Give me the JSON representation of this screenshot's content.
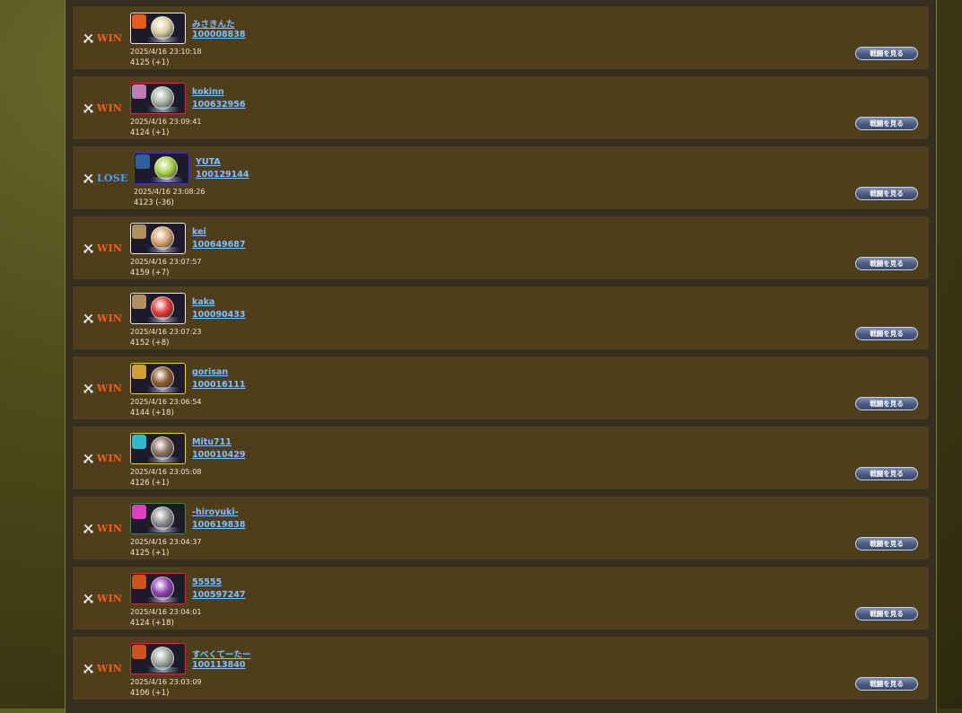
{
  "battles": [
    {
      "result": "WIN",
      "name": "みさきんた",
      "id": "100008838",
      "datetime": "2025/4/16 23:10:18",
      "rating": "4125 (+1)",
      "button": "戦闘を見る",
      "avatar_border": "#e8e8e8",
      "badge_color": "#e85a1a",
      "char_color": "#d8cfa0"
    },
    {
      "result": "WIN",
      "name": "kokinn",
      "id": "100632956",
      "datetime": "2025/4/16 23:09:41",
      "rating": "4124 (+1)",
      "button": "戦闘を見る",
      "avatar_border": "#d03030",
      "badge_color": "#c07ab8",
      "char_color": "#a8b0a0"
    },
    {
      "result": "LOSE",
      "name": "YUTA",
      "id": "100129144",
      "datetime": "2025/4/16 23:08:26",
      "rating": "4123 (-36)",
      "button": "戦闘を見る",
      "avatar_border": "#3a3aa0",
      "badge_color": "#3060a0",
      "char_color": "#a8d048"
    },
    {
      "result": "WIN",
      "name": "kei",
      "id": "100649687",
      "datetime": "2025/4/16 23:07:57",
      "rating": "4159 (+7)",
      "button": "戦闘を見る",
      "avatar_border": "#e8e8e8",
      "badge_color": "#b09060",
      "char_color": "#d8a070"
    },
    {
      "result": "WIN",
      "name": "kaka",
      "id": "100090433",
      "datetime": "2025/4/16 23:07:23",
      "rating": "4152 (+8)",
      "button": "戦闘を見る",
      "avatar_border": "#e8e8e8",
      "badge_color": "#b09060",
      "char_color": "#e03838"
    },
    {
      "result": "WIN",
      "name": "gorisan",
      "id": "100016111",
      "datetime": "2025/4/16 23:06:54",
      "rating": "4144 (+18)",
      "button": "戦闘を見る",
      "avatar_border": "#e8d040",
      "badge_color": "#d0a030",
      "char_color": "#8a5a30"
    },
    {
      "result": "WIN",
      "name": "Mitu711",
      "id": "100010429",
      "datetime": "2025/4/16 23:05:08",
      "rating": "4126 (+1)",
      "button": "戦闘を見る",
      "avatar_border": "#e8d040",
      "badge_color": "#30b8d0",
      "char_color": "#8a7060"
    },
    {
      "result": "WIN",
      "name": "-hiroyuki-",
      "id": "100619838",
      "datetime": "2025/4/16 23:04:37",
      "rating": "4125 (+1)",
      "button": "戦闘を見る",
      "avatar_border": "#3a8a3a",
      "badge_color": "#e040c0",
      "char_color": "#909090"
    },
    {
      "result": "WIN",
      "name": "55555",
      "id": "100597247",
      "datetime": "2025/4/16 23:04:01",
      "rating": "4124 (+18)",
      "button": "戦闘を見る",
      "avatar_border": "#d03030",
      "badge_color": "#d05020",
      "char_color": "#9040b0"
    },
    {
      "result": "WIN",
      "name": "すべくてーたー",
      "id": "100113840",
      "datetime": "2025/4/16 23:03:09",
      "rating": "4106 (+1)",
      "button": "戦闘を見る",
      "avatar_border": "#d03030",
      "badge_color": "#d05020",
      "char_color": "#a0a8a0"
    }
  ],
  "colors": {
    "win": "#ff5a14",
    "lose": "#4aa0ff",
    "link": "#7fc0ff",
    "row_bg": "#4f3e1c"
  },
  "icons": {
    "result": "crossed-swords-icon"
  }
}
